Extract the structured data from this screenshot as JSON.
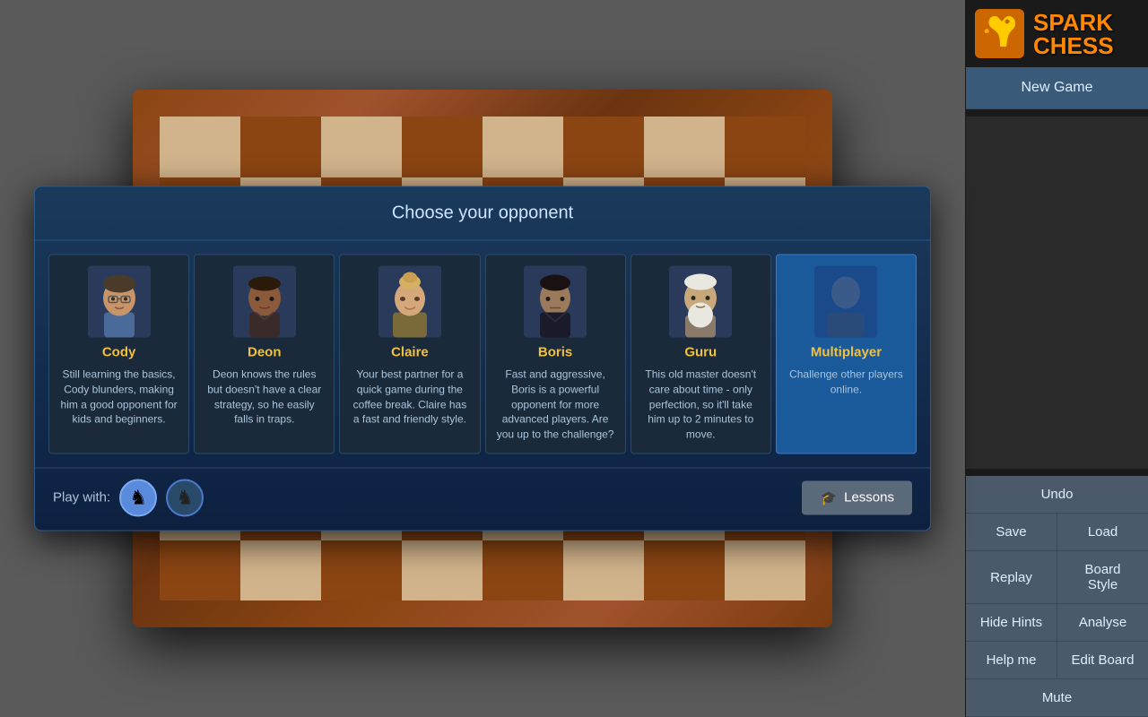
{
  "logo": {
    "spark": "SPARK",
    "chess": "CHESS"
  },
  "sidebar": {
    "new_game": "New Game",
    "undo": "Undo",
    "save": "Save",
    "load": "Load",
    "replay": "Replay",
    "board_style": "Board Style",
    "hide_hints": "Hide Hints",
    "analyse": "Analyse",
    "help_me": "Help me",
    "edit_board": "Edit Board",
    "mute": "Mute"
  },
  "dialog": {
    "title": "Choose your opponent",
    "play_with_label": "Play with:",
    "lessons_btn": "Lessons"
  },
  "opponents": [
    {
      "id": "cody",
      "name": "Cody",
      "color": "#f0c040",
      "desc": "Still learning the basics, Cody blunders, making him a good opponent for kids and beginners.",
      "selected": false
    },
    {
      "id": "deon",
      "name": "Deon",
      "color": "#f0c040",
      "desc": "Deon knows the rules but doesn't have a clear strategy, so he easily falls in traps.",
      "selected": false
    },
    {
      "id": "claire",
      "name": "Claire",
      "color": "#f0c040",
      "desc": "Your best partner for a quick game during the coffee break. Claire has a fast and friendly style.",
      "selected": false
    },
    {
      "id": "boris",
      "name": "Boris",
      "color": "#f0c040",
      "desc": "Fast and aggressive, Boris is a powerful opponent for more advanced players. Are you up to the challenge?",
      "selected": false
    },
    {
      "id": "guru",
      "name": "Guru",
      "color": "#f0c040",
      "desc": "This old master doesn't care about time - only perfection, so it'll take him up to 2 minutes to move.",
      "selected": false
    },
    {
      "id": "multiplayer",
      "name": "Multiplayer",
      "color": "#f0c040",
      "desc": "Challenge other players online.",
      "selected": true
    }
  ]
}
